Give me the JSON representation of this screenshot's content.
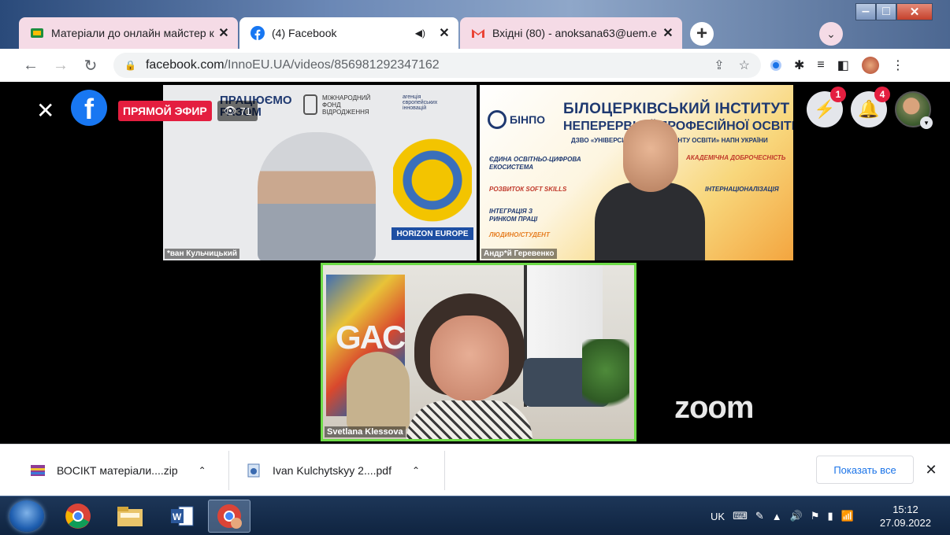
{
  "browser": {
    "tabs": [
      {
        "title": "Матеріали до онлайн майстер к",
        "favicon": "classroom-icon",
        "active": false
      },
      {
        "title": "(4) Facebook",
        "favicon": "facebook-icon",
        "active": true
      },
      {
        "title": "Вхідні (80) - anoksana63@uem.e",
        "favicon": "gmail-icon",
        "active": false
      }
    ],
    "new_tab": "+",
    "url_host": "facebook.com",
    "url_path": "/InnoEU.UA/videos/856981292347162"
  },
  "facebook": {
    "live_label": "ПРЯМОЙ ЭФИР",
    "viewer_count": "71",
    "messenger_badge": "1",
    "notifications_badge": "4"
  },
  "videos": {
    "v1": {
      "name": "*ван Кульчицький",
      "brand": "ПРАЦЮЄМО РАЗОМ",
      "fund": "МІЖНАРОДНИЙ ФОНД ВІДРОДЖЕННЯ",
      "agency": "агенція європейських інновацій",
      "program": "HORIZON EUROPE"
    },
    "v2": {
      "name": "Андр*й Геревенко",
      "short": "БІНПО",
      "title_line1": "БІЛОЦЕРКІВСЬКИЙ ІНСТИТУТ",
      "title_line2": "НЕПЕРЕРВНОЇ ПРОФЕСІЙНОЇ ОСВІТИ",
      "title_line3": "ДЗВО «УНІВЕРСИТЕТ МЕНЕДЖМЕНТУ ОСВІТИ» НАПН УКРАЇНИ",
      "tags": [
        "ЄДИНА ОСВІТНЬО-ЦИФРОВА ЕКОСИСТЕМА",
        "РОЗВИТОК SOFT SKILLS",
        "ІНТЕГРАЦІЯ З РИНКОМ ПРАЦІ",
        "ЛЮДИНО/СТУДЕНТ",
        "АКАДЕМІЧНА ДОБРОЧЕСНІСТЬ",
        "ІНТЕРНАЦІОНАЛІЗАЦІЯ"
      ]
    },
    "v3": {
      "name": "Svetlana Klessova",
      "art_text": "GAC"
    },
    "watermark": "zoom"
  },
  "downloads": {
    "items": [
      {
        "name": "ВОСІКТ матеріали....zip",
        "icon": "archive-icon"
      },
      {
        "name": "Ivan Kulchytskyy 2....pdf",
        "icon": "pdf-icon"
      }
    ],
    "show_all": "Показать все"
  },
  "taskbar": {
    "language": "UK",
    "time": "15:12",
    "date": "27.09.2022"
  },
  "colors": {
    "facebook_blue": "#1877f2",
    "live_red": "#e41e3f",
    "active_speaker_border": "#6ddb47",
    "link_blue": "#1a73e8"
  }
}
